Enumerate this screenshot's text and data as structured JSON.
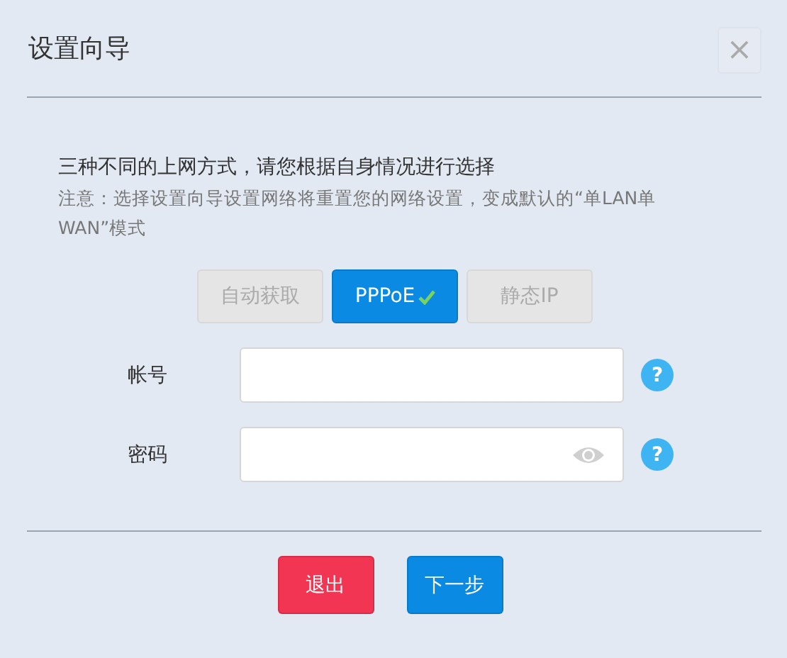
{
  "dialog": {
    "title": "设置向导",
    "close": "×"
  },
  "intro": "三种不同的上网方式，请您根据自身情况进行选择",
  "note": "注意：选择设置向导设置网络将重置您的网络设置，变成默认的“单LAN单WAN”模式",
  "modes": [
    {
      "label": "自动获取",
      "selected": false
    },
    {
      "label": "PPPoE",
      "selected": true
    },
    {
      "label": "静态IP",
      "selected": false
    }
  ],
  "fields": [
    {
      "label": "帐号",
      "kind": "text",
      "help": "?"
    },
    {
      "label": "密码",
      "kind": "password",
      "help": "?"
    }
  ],
  "buttons": [
    {
      "label": "退出",
      "kind": "cancel"
    },
    {
      "label": "下一步",
      "kind": "primary"
    }
  ]
}
